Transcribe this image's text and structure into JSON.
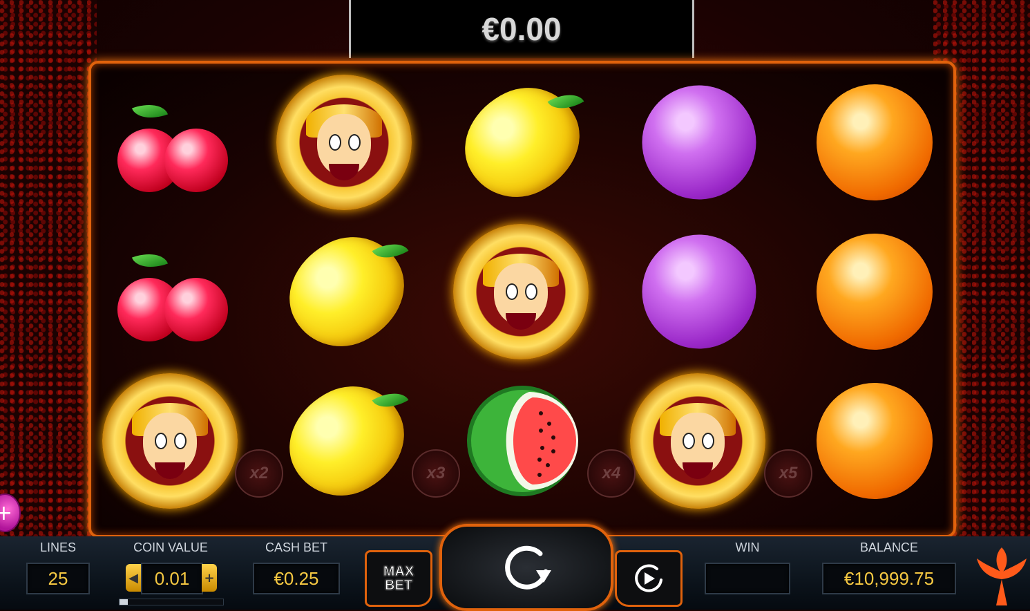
{
  "top_win": {
    "amount": "€0.00"
  },
  "reels": [
    [
      "cherry",
      "joker",
      "lemon",
      "plum",
      "orange"
    ],
    [
      "cherry",
      "lemon",
      "joker",
      "plum",
      "orange"
    ],
    [
      "joker",
      "lemon",
      "watermelon",
      "joker",
      "orange"
    ]
  ],
  "multipliers": [
    "x2",
    "x3",
    "x4",
    "x5"
  ],
  "side_button": {
    "label": "+"
  },
  "panel": {
    "lines_label": "LINES",
    "lines_value": "25",
    "coin_value_label": "COIN VALUE",
    "coin_value": "0.01",
    "coin_decrease": "◀",
    "coin_increase": "+",
    "coin_value_progress": 0.08,
    "cash_bet_label": "CASH BET",
    "cash_bet_value": "€0.25",
    "max_bet_line1": "MAX",
    "max_bet_line2": "BET",
    "win_label": "WIN",
    "win_value": "",
    "balance_label": "BALANCE",
    "balance_value": "€10,999.75"
  },
  "colors": {
    "frame": "#e0620c",
    "value_text": "#f5c842",
    "label_text": "#d0d6de"
  },
  "icons": {
    "spin": "spin-arrow-icon",
    "autoplay": "autoplay-icon",
    "logo": "brand-logo-icon"
  }
}
